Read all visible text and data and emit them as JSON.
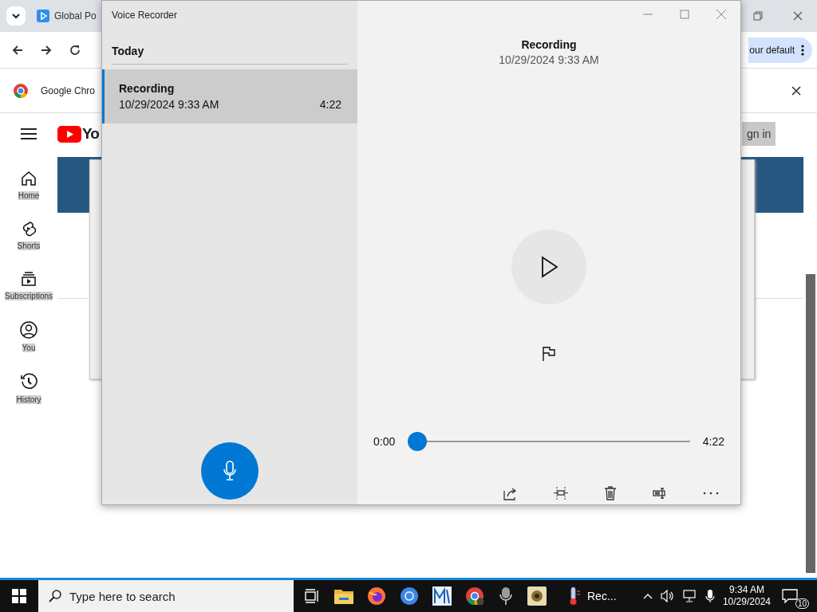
{
  "browser": {
    "tab_title": "Global Po",
    "default_banner": "our default",
    "info_bar": "Google Chro",
    "logo_text": "Yo",
    "sign_in": "gn in",
    "sidebar": [
      {
        "label": "Home",
        "kind": "home"
      },
      {
        "label": "Shorts",
        "kind": "shorts"
      },
      {
        "label": "Subscriptions",
        "kind": "subscriptions"
      },
      {
        "label": "You",
        "kind": "you"
      },
      {
        "label": "History",
        "kind": "history"
      }
    ]
  },
  "recorder": {
    "title": "Voice Recorder",
    "group": "Today",
    "recordings": [
      {
        "name": "Recording",
        "date": "10/29/2024 9:33 AM",
        "duration": "4:22",
        "selected": true
      }
    ],
    "current": {
      "name": "Recording",
      "date": "10/29/2024 9:33 AM"
    },
    "position": "0:00",
    "length": "4:22",
    "progress": {
      "level": 0
    }
  },
  "taskbar": {
    "search_placeholder": "Type here to search",
    "running_label": "Rec...",
    "time": "9:34 AM",
    "date": "10/29/2024",
    "notifications": "10"
  }
}
